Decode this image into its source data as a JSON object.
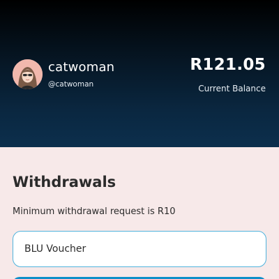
{
  "profile": {
    "username": "catwoman",
    "handle": "@catwoman",
    "avatar": "avatar-icon"
  },
  "balance": {
    "amount": "R121.05",
    "label": "Current Balance"
  },
  "withdrawals": {
    "title": "Withdrawals",
    "minimum_note": "Minimum withdrawal request is R10",
    "method_value": "BLU Voucher"
  },
  "colors": {
    "header_gradient_top": "#000000",
    "header_gradient_bottom": "#0c2f4d",
    "page_background": "#f7e9e9",
    "accent": "#4fb3dd",
    "button": "#0e8fc9"
  }
}
